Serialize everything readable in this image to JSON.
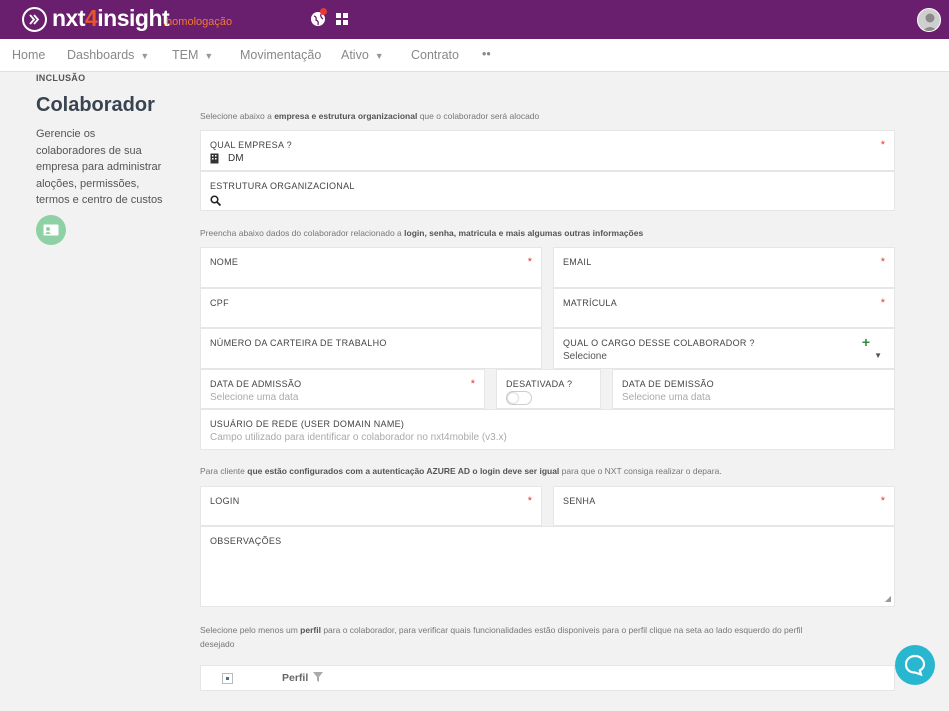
{
  "header": {
    "brand": "nxt",
    "brand_four": "4",
    "brand_rest": "insight",
    "environment": ".homologação"
  },
  "menu": {
    "items": [
      "Home",
      "Dashboards",
      "TEM",
      "Movimentação",
      "Ativo",
      "Contrato",
      "••"
    ]
  },
  "sidebar": {
    "crumb": "INCLUSÃO",
    "title": "Colaborador",
    "description": "Gerencie os colaboradores de sua empresa para administrar aloções, permissões, termos e centro de custos"
  },
  "hints": {
    "h1_a": "Selecione abaixo a ",
    "h1_b": "empresa e estrutura organizacional",
    "h1_c": " que o colaborador será alocado",
    "h2_a": "Preencha abaixo dados do colaborador relacionado a ",
    "h2_b": "login, senha, matricula e mais algumas outras informações",
    "h3_a": "Para cliente ",
    "h3_b": "que estão configurados com a autenticação AZURE AD o login deve ser igual",
    "h3_c": " para que o NXT consiga realizar o depara.",
    "h4_a": "Selecione pelo menos um ",
    "h4_b": "perfil",
    "h4_c": " para o colaborador, para verificar quais funcionalidades estão disponiveis para o perfil clique na seta ao lado esquerdo do perfil",
    "h4_d": "desejado"
  },
  "form": {
    "required_mark": "*",
    "plus": "+",
    "caret": "▼",
    "empresa": {
      "label": "QUAL EMPRESA ?",
      "value": "DM"
    },
    "estrutura": {
      "label": "ESTRUTURA ORGANIZACIONAL"
    },
    "nome": {
      "label": "NOME"
    },
    "email": {
      "label": "EMAIL"
    },
    "cpf": {
      "label": "CPF"
    },
    "matricula": {
      "label": "MATRÍCULA"
    },
    "carteira": {
      "label": "NÚMERO DA CARTEIRA DE TRABALHO"
    },
    "cargo": {
      "label": "QUAL O CARGO DESSE COLABORADOR ?",
      "value": "Selecione"
    },
    "admissao": {
      "label": "DATA DE ADMISSÃO",
      "placeholder": "Selecione uma data"
    },
    "desativada": {
      "label": "DESATIVADA ?",
      "on": false
    },
    "demissao": {
      "label": "DATA DE DEMISSÃO",
      "placeholder": "Selecione uma data"
    },
    "usuario": {
      "label": "USUÁRIO DE REDE (USER DOMAIN NAME)",
      "placeholder": "Campo utilizado para identificar o colaborador no nxt4mobile (v3.x)"
    },
    "login": {
      "label": "LOGIN"
    },
    "senha": {
      "label": "SENHA"
    },
    "observacoes": {
      "label": "OBSERVAÇÕES"
    }
  },
  "table": {
    "column": "Perfil"
  },
  "colors": {
    "topbar": "#6a1f6e",
    "accent_orange": "#e8542e",
    "required": "#e53935",
    "chat": "#29b6cf",
    "plus": "#2e8b3d"
  },
  "icons": [
    "chevrons-right-icon",
    "globe-icon",
    "grid-icon",
    "user-avatar-icon",
    "building-icon",
    "search-icon",
    "id-card-icon",
    "filter-icon",
    "chat-icon"
  ]
}
